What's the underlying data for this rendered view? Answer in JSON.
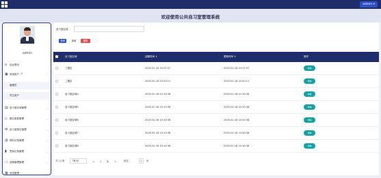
{
  "topbar": {
    "user_button": "admin ▾"
  },
  "header": {
    "title": "欢迎使用公共自习室管理系统"
  },
  "sidebar": {
    "username": "admin",
    "items": [
      {
        "label": "后台首页",
        "icon": "home-icon",
        "glyph": "⌂",
        "has_children": false
      },
      {
        "label": "系统用户",
        "icon": "user-group-icon",
        "glyph": "▣",
        "has_children": true,
        "children": [
          "管理员",
          "学生用户"
        ]
      },
      {
        "label": "自习室区域管理",
        "icon": "area-icon",
        "glyph": "▤",
        "has_children": true
      },
      {
        "label": "座位类型管理",
        "icon": "tag-icon",
        "glyph": "◇",
        "has_children": true
      },
      {
        "label": "自习室座位管理",
        "icon": "seat-icon",
        "glyph": "⚙",
        "has_children": true
      },
      {
        "label": "预约记录管理",
        "icon": "calendar-icon",
        "glyph": "▥",
        "has_children": true
      },
      {
        "label": "签到记录管理",
        "icon": "document-icon",
        "glyph": "▮",
        "has_children": true
      },
      {
        "label": "违规管理管理",
        "icon": "monitor-icon",
        "glyph": "▭",
        "has_children": true
      },
      {
        "label": "系统管理",
        "icon": "settings-icon",
        "glyph": "▦",
        "has_children": true
      }
    ]
  },
  "search": {
    "label": "自习室区域",
    "placeholder": ""
  },
  "toolbar": {
    "query": "查询",
    "add": "新增",
    "delete": "删除"
  },
  "table": {
    "columns": [
      "自习室区域",
      "创建时间 ⇕",
      "更新时间 ⇕",
      "操作"
    ],
    "action_label": "详情",
    "rows": [
      [
        "三楼区",
        "2025-02-18 10:27:07",
        "2025-02-18 10:27:07"
      ],
      [
        "二楼区",
        "2025-02-18 10:20:11",
        "2025-02-18 10:20:11"
      ],
      [
        "自习室区域4",
        "2025-02-18 10:10:36",
        "2025-02-18 10:10:36"
      ],
      [
        "自习室区域5",
        "2025-02-18 10:10:36",
        "2025-02-18 10:10:36"
      ],
      [
        "自习室区域6",
        "2025-02-18 10:10:36",
        "2025-02-18 10:10:36"
      ],
      [
        "自习室区域7",
        "2025-02-18 10:10:36",
        "2025-02-18 10:10:36"
      ],
      [
        "自习室区域8",
        "2025-02-18 10:10:36",
        "2025-02-18 10:10:36"
      ]
    ]
  },
  "pagination": {
    "total": "共 13 条",
    "page_size": "7条/页",
    "prev": "<",
    "pages": [
      "1",
      "2"
    ],
    "current": "2",
    "next": ">",
    "goto_label": "前往",
    "goto_value": "2",
    "goto_unit": "页"
  },
  "colors": {
    "navbar": "#1f2d6b",
    "primary": "#2c4fc4",
    "danger": "#e04b4b",
    "detail": "#17a2a0"
  }
}
